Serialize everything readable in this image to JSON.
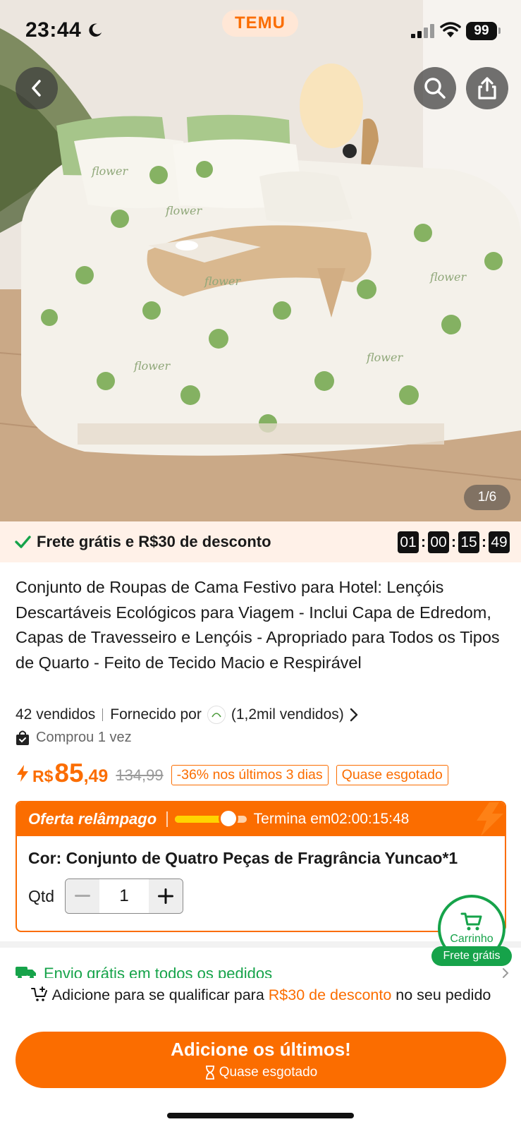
{
  "status_bar": {
    "time": "23:44",
    "battery": "99",
    "app_badge": "TEMU"
  },
  "gallery": {
    "pager": "1/6",
    "print_words": [
      "flower",
      "flower",
      "flower",
      "flower",
      "flower",
      "flower"
    ]
  },
  "promo": {
    "text": "Frete grátis e R$30 de desconto",
    "countdown": [
      "01",
      "00",
      "15",
      "49"
    ]
  },
  "product": {
    "title": "Conjunto de Roupas de Cama Festivo para Hotel: Lençóis Descartáveis Ecológicos para Viagem - Inclui Capa de Edredom, Capas de Travesseiro e Lençóis - Apropriado para Todos os Tipos de Quarto - Feito de Tecido Macio e Respirável",
    "sold": "42 vendidos",
    "supplied_by": "Fornecido por",
    "seller_sold": "(1,2mil vendidos)",
    "bought": "Comprou 1 vez"
  },
  "price": {
    "currency": "R$",
    "integer": "85",
    "decimal": ",49",
    "old": "134,99",
    "discount_tag": "-36% nos últimos 3 dias",
    "stock_tag": "Quase esgotado"
  },
  "flash": {
    "title": "Oferta relâmpago",
    "ends_label": "Termina em",
    "ends_time": "02:00:15:48",
    "progress": 0.75,
    "color_label": "Cor: Conjunto de Quatro Peças de Fragrância Yuncao*1",
    "qty_label": "Qtd",
    "qty_value": "1"
  },
  "cart_float": {
    "label": "Carrinho",
    "badge": "Frete grátis"
  },
  "shipping": {
    "text": "Envio grátis em todos os pedidos"
  },
  "bottom": {
    "qualify_pre": "Adicione para se qualificar para ",
    "qualify_hl": "R$30 de desconto",
    "qualify_post": " no seu pedido",
    "cta_main": "Adicione os últimos!",
    "cta_sub": "Quase esgotado"
  },
  "colors": {
    "accent": "#fb6d00",
    "green": "#16a34a",
    "promo_bg": "#fff1e8"
  }
}
